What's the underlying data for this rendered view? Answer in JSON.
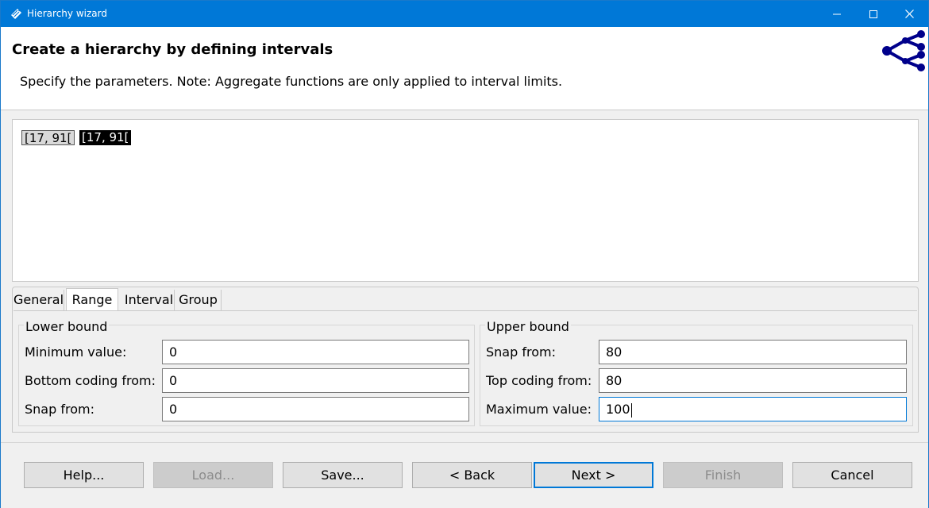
{
  "window": {
    "title": "Hierarchy wizard",
    "accent_color": "#0078d7",
    "controls": [
      "minimize-icon",
      "maximize-icon",
      "close-icon"
    ]
  },
  "header": {
    "title": "Create a hierarchy by defining intervals",
    "description": "Specify the parameters. Note: Aggregate functions are only applied to interval limits.",
    "logo_icon": "hierarchy-tree-icon"
  },
  "preview": {
    "nodes": [
      "[17, 91[",
      "[17, 91["
    ]
  },
  "tabs": {
    "items": [
      "General",
      "Range",
      "Interval",
      "Group"
    ],
    "active": "Range"
  },
  "lower_bound": {
    "title": "Lower bound",
    "minimum_label": "Minimum value:",
    "minimum_value": "0",
    "bottom_coding_label": "Bottom coding from:",
    "bottom_coding_value": "0",
    "snap_label": "Snap from:",
    "snap_value": "0"
  },
  "upper_bound": {
    "title": "Upper bound",
    "snap_label": "Snap from:",
    "snap_value": "80",
    "top_coding_label": "Top coding from:",
    "top_coding_value": "80",
    "maximum_label": "Maximum value:",
    "maximum_value": "100"
  },
  "buttons": {
    "help": "Help...",
    "load": "Load...",
    "save": "Save...",
    "back": "< Back",
    "next": "Next >",
    "finish": "Finish",
    "cancel": "Cancel"
  }
}
